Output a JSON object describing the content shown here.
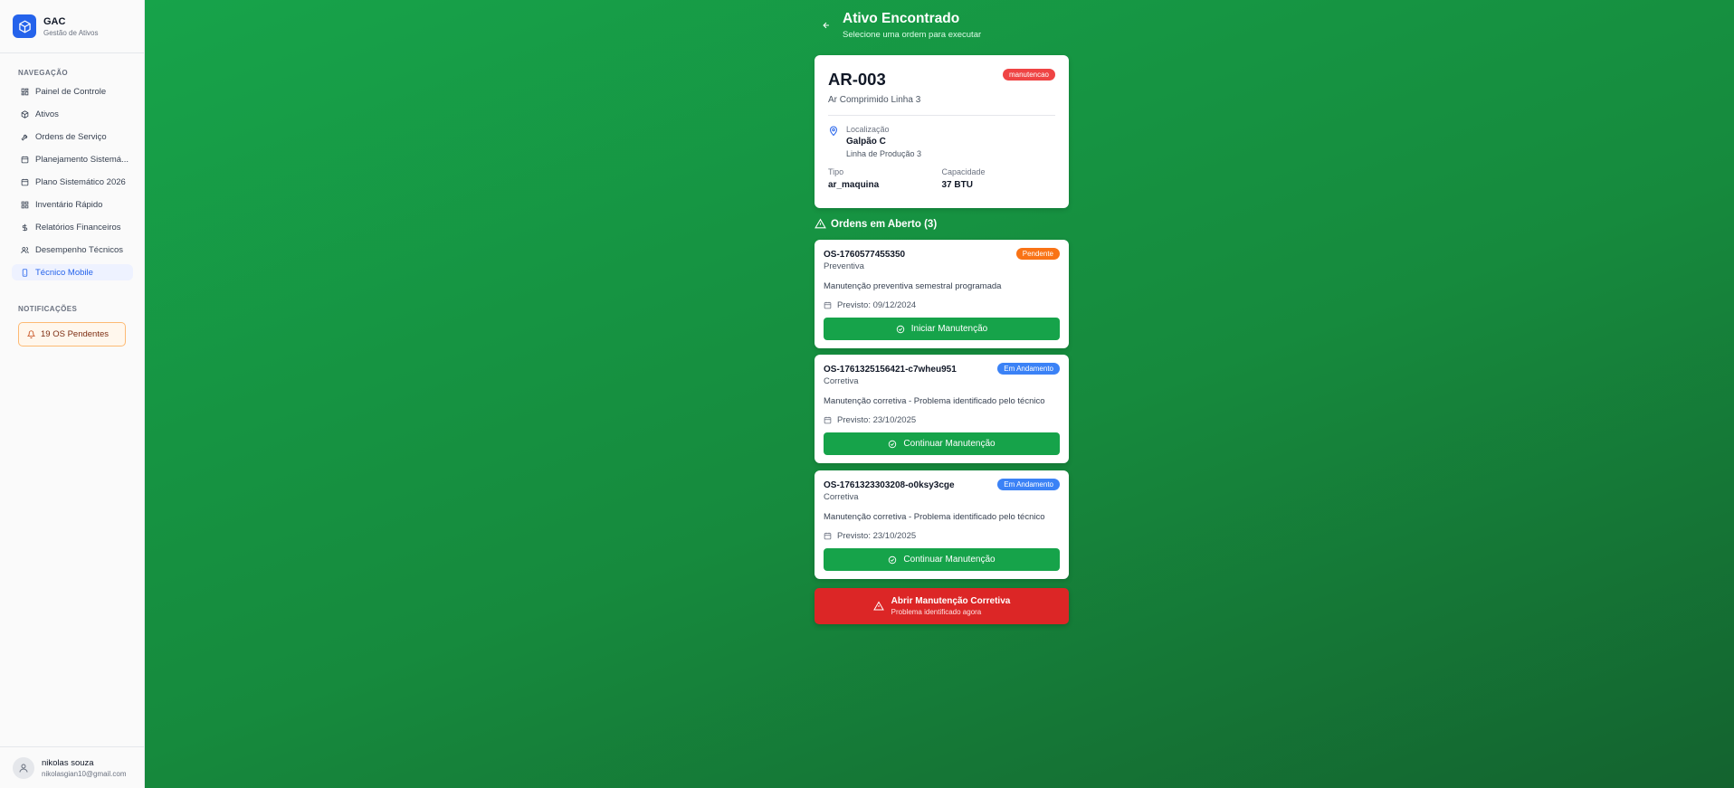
{
  "brand": {
    "title": "GAC",
    "subtitle": "Gestão de Ativos"
  },
  "sidebar": {
    "nav_label": "NAVEGAÇÃO",
    "items": [
      {
        "label": "Painel de Controle",
        "icon": "dashboard-icon"
      },
      {
        "label": "Ativos",
        "icon": "box-icon"
      },
      {
        "label": "Ordens de Serviço",
        "icon": "wrench-icon"
      },
      {
        "label": "Planejamento Sistemá...",
        "icon": "calendar-icon"
      },
      {
        "label": "Plano Sistemático 2026",
        "icon": "calendar-icon"
      },
      {
        "label": "Inventário Rápido",
        "icon": "scan-icon"
      },
      {
        "label": "Relatórios Financeiros",
        "icon": "dollar-icon"
      },
      {
        "label": "Desempenho Técnicos",
        "icon": "users-icon"
      },
      {
        "label": "Técnico Mobile",
        "icon": "smartphone-icon",
        "active": true
      }
    ],
    "notifications_label": "NOTIFICAÇÕES",
    "notification": "19 OS Pendentes"
  },
  "user": {
    "name": "nikolas souza",
    "email": "nikolasgian10@gmail.com"
  },
  "header": {
    "title": "Ativo Encontrado",
    "subtitle": "Selecione uma ordem para executar"
  },
  "asset": {
    "code": "AR-003",
    "name": "Ar Comprimido Linha 3",
    "status": "manutencao",
    "location_label": "Localização",
    "location_value": "Galpão C",
    "location_sub": "Linha de Produção 3",
    "type_label": "Tipo",
    "type_value": "ar_maquina",
    "capacity_label": "Capacidade",
    "capacity_value": "37 BTU"
  },
  "orders_heading": "Ordens em Aberto (3)",
  "orders": [
    {
      "id": "OS-1760577455350",
      "type": "Preventiva",
      "status": "Pendente",
      "description": "Manutenção preventiva semestral programada",
      "date": "Previsto: 09/12/2024",
      "action": "Iniciar Manutenção"
    },
    {
      "id": "OS-1761325156421-c7wheu951",
      "type": "Corretiva",
      "status": "Em Andamento",
      "description": "Manutenção corretiva - Problema identificado pelo técnico",
      "date": "Previsto: 23/10/2025",
      "action": "Continuar Manutenção"
    },
    {
      "id": "OS-1761323303208-o0ksy3cge",
      "type": "Corretiva",
      "status": "Em Andamento",
      "description": "Manutenção corretiva - Problema identificado pelo técnico",
      "date": "Previsto: 23/10/2025",
      "action": "Continuar Manutenção"
    }
  ],
  "corrective": {
    "title": "Abrir Manutenção Corretiva",
    "subtitle": "Problema identificado agora"
  },
  "colors": {
    "accent": "#2563eb",
    "success": "#16a34a",
    "danger": "#dc2626",
    "pending": "#f97316",
    "in_progress": "#3b82f6"
  }
}
